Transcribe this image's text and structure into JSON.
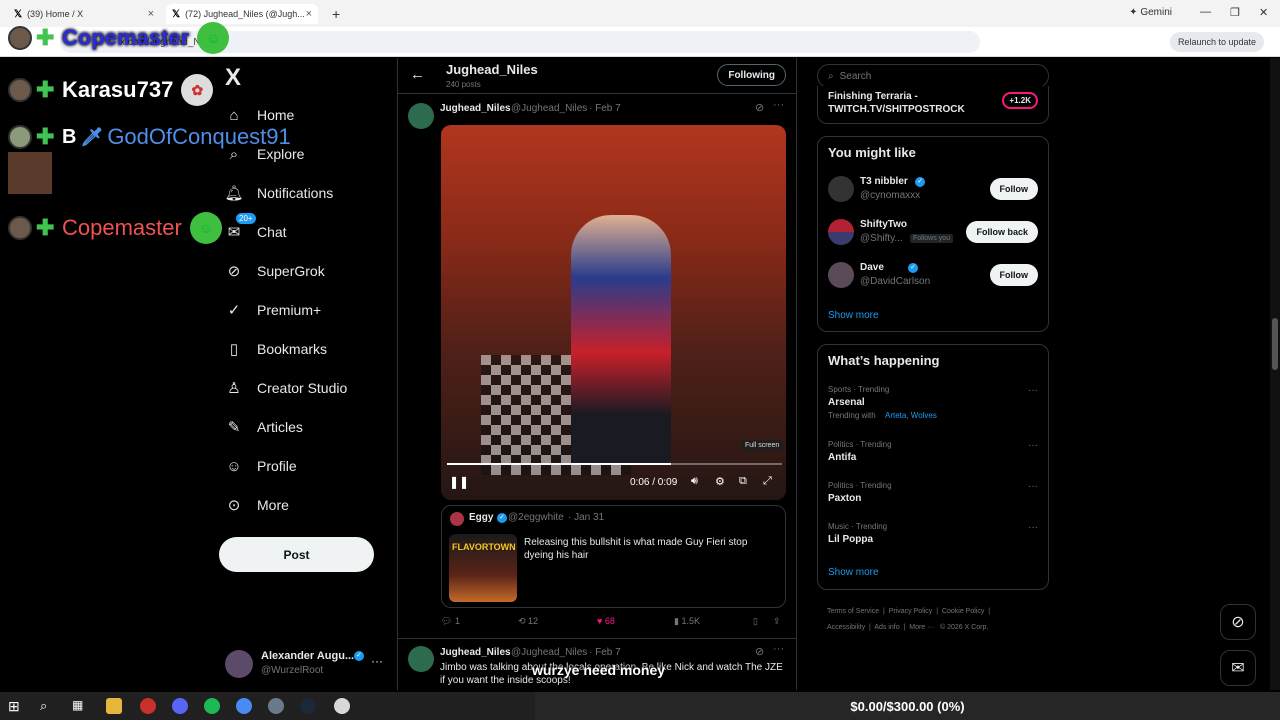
{
  "browser": {
    "tabs": [
      {
        "title": "(39) Home / X"
      },
      {
        "title": "(72) Jughead_Niles (@Jugh..."
      }
    ],
    "new_tab_label": "+",
    "url": "x.com/Jughead_N...",
    "gemini_label": "Gemini",
    "relaunch_label": "Relaunch to update"
  },
  "stream_overlay": {
    "messages": [
      {
        "user": "Copemaster",
        "color": "#2b2bd9"
      },
      {
        "user": "Karasu737",
        "color": "#ffffff"
      },
      {
        "user": "GodOfConquest91",
        "prefix": "B",
        "color": "#4f8fe8"
      },
      {
        "user": "Copemaster",
        "color": "#f05151"
      }
    ],
    "caption": "wurzye need money",
    "goal": "$0.00/$300.00 (0%)"
  },
  "nav": {
    "logo": "X",
    "items": [
      {
        "label": "Home",
        "icon": "home-icon"
      },
      {
        "label": "Explore",
        "icon": "search-icon"
      },
      {
        "label": "Notifications",
        "icon": "bell-icon"
      },
      {
        "label": "Chat",
        "icon": "chat-icon",
        "badge": "20+"
      },
      {
        "label": "SuperGrok",
        "icon": "grok-icon"
      },
      {
        "label": "Premium+",
        "icon": "premium-icon"
      },
      {
        "label": "Bookmarks",
        "icon": "bookmark-icon"
      },
      {
        "label": "Creator Studio",
        "icon": "creator-icon"
      },
      {
        "label": "Articles",
        "icon": "articles-icon"
      },
      {
        "label": "Profile",
        "icon": "profile-icon"
      },
      {
        "label": "More",
        "icon": "more-icon"
      }
    ],
    "post_label": "Post",
    "account": {
      "name": "Alexander Augu...",
      "handle": "@WurzelRoot"
    }
  },
  "profile_header": {
    "name": "Jughead_Niles",
    "posts": "240 posts",
    "following_label": "Following"
  },
  "posts": [
    {
      "author": "Jughead_Niles",
      "handle": "@Jughead_Niles",
      "date": "· Feb 7",
      "video": {
        "time": "0:06 / 0:09",
        "progress": 0.67,
        "fullscreen_tooltip": "Full screen"
      },
      "quote": {
        "author": "Eggy",
        "handle": "@2eggwhite",
        "date": "· Jan 31",
        "text": "Releasing this bullshit is what made Guy Fieri stop dyeing his hair",
        "thumb_text": "FLAVORTOWN"
      },
      "stats": {
        "replies": "1",
        "reposts": "12",
        "likes": "68",
        "views": "1.5K"
      }
    },
    {
      "author": "Jughead_Niles",
      "handle": "@Jughead_Niles",
      "date": "· Feb 7",
      "text": "Jimbo was talking about the locals operation. Be like Nick and watch The JZE if you want the inside scoops!"
    }
  ],
  "right": {
    "search_placeholder": "Search",
    "live": {
      "title": "Finishing Terraria - TWITCH.TV/SHITPOSTROCK",
      "count": "+1.2K"
    },
    "might_like": {
      "title": "You might like",
      "users": [
        {
          "name": "T3 nibbler",
          "handle": "@cynomaxxx",
          "button": "Follow",
          "verified": true
        },
        {
          "name": "ShiftyTwo",
          "handle": "@Shifty...",
          "follows_you": "Follows you",
          "button": "Follow back",
          "verified": false
        },
        {
          "name": "Dave",
          "handle": "@DavidCarlson",
          "button": "Follow",
          "verified": true
        }
      ],
      "show_more": "Show more"
    },
    "happening": {
      "title": "What’s happening",
      "trends": [
        {
          "context": "Sports · Trending",
          "name": "Arsenal",
          "with_label": "Trending with",
          "with": "Arteta, Wolves"
        },
        {
          "context": "Politics · Trending",
          "name": "Antifa"
        },
        {
          "context": "Politics · Trending",
          "name": "Paxton"
        },
        {
          "context": "Music · Trending",
          "name": "Lil Poppa"
        }
      ],
      "show_more": "Show more"
    },
    "footer": {
      "links": [
        "Terms of Service",
        "Privacy Policy",
        "Cookie Policy",
        "Accessibility",
        "Ads info",
        "More ···"
      ],
      "copyright": "© 2026 X Corp."
    }
  }
}
